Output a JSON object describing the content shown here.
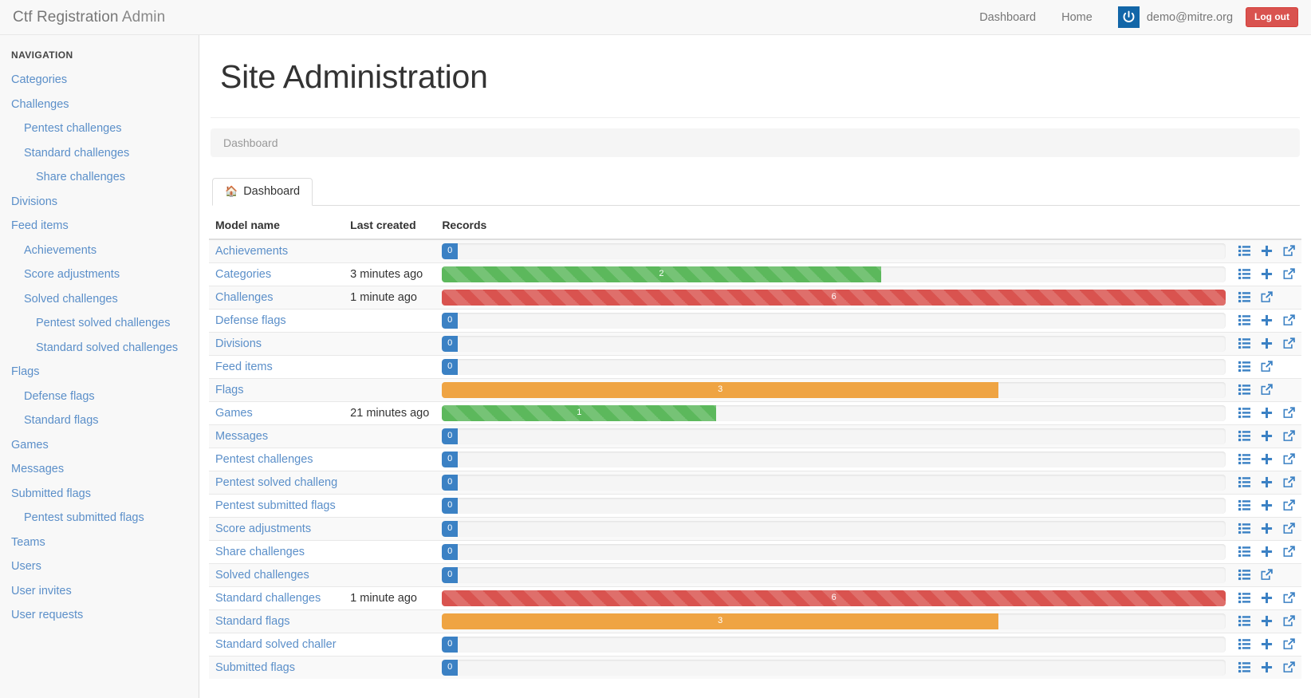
{
  "navbar": {
    "brand_main": "Ctf Registration",
    "brand_sub": "Admin",
    "links": [
      {
        "label": "Dashboard",
        "name": "nav-link-dashboard"
      },
      {
        "label": "Home",
        "name": "nav-link-home"
      }
    ],
    "user_email": "demo@mitre.org",
    "user_icon": "power-icon",
    "logout_label": "Log out",
    "accent_blue": "#1266a8",
    "logout_color": "#d9534f"
  },
  "sidebar": {
    "heading": "NAVIGATION",
    "items": [
      {
        "label": "Categories",
        "level": 0
      },
      {
        "label": "Challenges",
        "level": 0
      },
      {
        "label": "Pentest challenges",
        "level": 1
      },
      {
        "label": "Standard challenges",
        "level": 1
      },
      {
        "label": "Share challenges",
        "level": 2
      },
      {
        "label": "Divisions",
        "level": 0
      },
      {
        "label": "Feed items",
        "level": 0
      },
      {
        "label": "Achievements",
        "level": 1
      },
      {
        "label": "Score adjustments",
        "level": 1
      },
      {
        "label": "Solved challenges",
        "level": 1
      },
      {
        "label": "Pentest solved challenges",
        "level": 2
      },
      {
        "label": "Standard solved challenges",
        "level": 2
      },
      {
        "label": "Flags",
        "level": 0
      },
      {
        "label": "Defense flags",
        "level": 1
      },
      {
        "label": "Standard flags",
        "level": 1
      },
      {
        "label": "Games",
        "level": 0
      },
      {
        "label": "Messages",
        "level": 0
      },
      {
        "label": "Submitted flags",
        "level": 0
      },
      {
        "label": "Pentest submitted flags",
        "level": 1
      },
      {
        "label": "Teams",
        "level": 0
      },
      {
        "label": "Users",
        "level": 0
      },
      {
        "label": "User invites",
        "level": 0
      },
      {
        "label": "User requests",
        "level": 0
      }
    ]
  },
  "main": {
    "page_title": "Site Administration",
    "breadcrumb": "Dashboard",
    "tab_label": "Dashboard",
    "tab_icon": "home-icon",
    "columns": {
      "model_name": "Model name",
      "last_created": "Last created",
      "records": "Records"
    },
    "action_icons": {
      "list": "list-icon",
      "add": "plus-icon",
      "open": "external-link-icon"
    },
    "rows": [
      {
        "model": "Achievements",
        "last_created": "",
        "count": "0",
        "pct": 2,
        "color": "blue",
        "actions": [
          "list",
          "add",
          "open"
        ]
      },
      {
        "model": "Categories",
        "last_created": "3 minutes ago",
        "count": "2",
        "pct": 56,
        "color": "green",
        "actions": [
          "list",
          "add",
          "open"
        ]
      },
      {
        "model": "Challenges",
        "last_created": "1 minute ago",
        "count": "6",
        "pct": 100,
        "color": "red",
        "actions": [
          "list",
          "open"
        ]
      },
      {
        "model": "Defense flags",
        "last_created": "",
        "count": "0",
        "pct": 2,
        "color": "blue",
        "actions": [
          "list",
          "add",
          "open"
        ]
      },
      {
        "model": "Divisions",
        "last_created": "",
        "count": "0",
        "pct": 2,
        "color": "blue",
        "actions": [
          "list",
          "add",
          "open"
        ]
      },
      {
        "model": "Feed items",
        "last_created": "",
        "count": "0",
        "pct": 2,
        "color": "blue",
        "actions": [
          "list",
          "open"
        ]
      },
      {
        "model": "Flags",
        "last_created": "",
        "count": "3",
        "pct": 71,
        "color": "orange",
        "actions": [
          "list",
          "open"
        ]
      },
      {
        "model": "Games",
        "last_created": "21 minutes ago",
        "count": "1",
        "pct": 35,
        "color": "green",
        "actions": [
          "list",
          "add",
          "open"
        ]
      },
      {
        "model": "Messages",
        "last_created": "",
        "count": "0",
        "pct": 2,
        "color": "blue",
        "actions": [
          "list",
          "add",
          "open"
        ]
      },
      {
        "model": "Pentest challenges",
        "last_created": "",
        "count": "0",
        "pct": 2,
        "color": "blue",
        "actions": [
          "list",
          "add",
          "open"
        ]
      },
      {
        "model": "Pentest solved challeng",
        "last_created": "",
        "count": "0",
        "pct": 2,
        "color": "blue",
        "actions": [
          "list",
          "add",
          "open"
        ]
      },
      {
        "model": "Pentest submitted flags",
        "last_created": "",
        "count": "0",
        "pct": 2,
        "color": "blue",
        "actions": [
          "list",
          "add",
          "open"
        ]
      },
      {
        "model": "Score adjustments",
        "last_created": "",
        "count": "0",
        "pct": 2,
        "color": "blue",
        "actions": [
          "list",
          "add",
          "open"
        ]
      },
      {
        "model": "Share challenges",
        "last_created": "",
        "count": "0",
        "pct": 2,
        "color": "blue",
        "actions": [
          "list",
          "add",
          "open"
        ]
      },
      {
        "model": "Solved challenges",
        "last_created": "",
        "count": "0",
        "pct": 2,
        "color": "blue",
        "actions": [
          "list",
          "open"
        ]
      },
      {
        "model": "Standard challenges",
        "last_created": "1 minute ago",
        "count": "6",
        "pct": 100,
        "color": "red",
        "actions": [
          "list",
          "add",
          "open"
        ]
      },
      {
        "model": "Standard flags",
        "last_created": "",
        "count": "3",
        "pct": 71,
        "color": "orange",
        "actions": [
          "list",
          "add",
          "open"
        ]
      },
      {
        "model": "Standard solved challer",
        "last_created": "",
        "count": "0",
        "pct": 2,
        "color": "blue",
        "actions": [
          "list",
          "add",
          "open"
        ]
      },
      {
        "model": "Submitted flags",
        "last_created": "",
        "count": "0",
        "pct": 2,
        "color": "blue",
        "actions": [
          "list",
          "add",
          "open"
        ]
      }
    ]
  }
}
